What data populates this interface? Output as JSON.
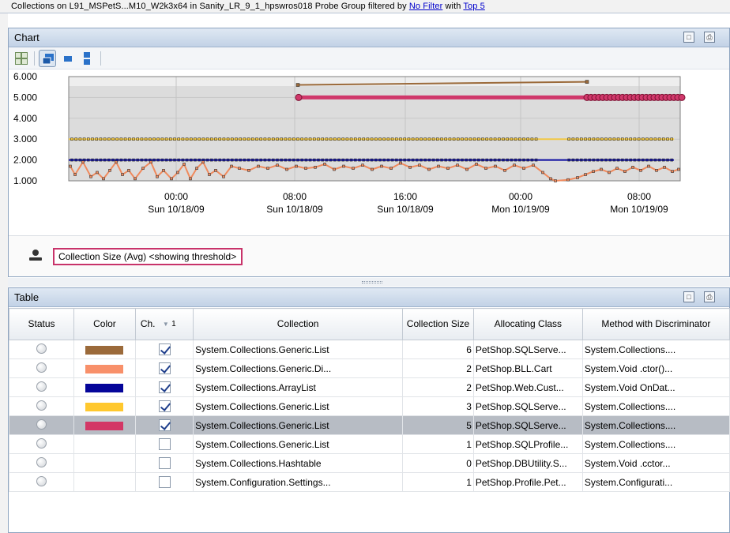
{
  "header": {
    "prefix": "Collections on L91_MSPetS...M10_W2k3x64 in Sanity_LR_9_1_hpswros018 Probe Group filtered by ",
    "filter_link": "No Filter",
    "with_text": " with ",
    "top_link": "Top 5"
  },
  "chart_panel": {
    "title": "Chart",
    "toolbar_icons": [
      "grid-view-icon",
      "overlay-view-icon",
      "single-view-icon",
      "stacked-view-icon"
    ],
    "legend_icon": "person-icon",
    "legend_label": "Collection Size (Avg) <showing threshold>"
  },
  "chart_data": {
    "type": "line",
    "y_ticks": [
      "6.000",
      "5.000",
      "4.000",
      "3.000",
      "2.000",
      "1.000"
    ],
    "ylim": [
      1,
      6
    ],
    "x_ticks": [
      {
        "time": "00:00",
        "day": "Sun 10/18/09"
      },
      {
        "time": "08:00",
        "day": "Sun 10/18/09"
      },
      {
        "time": "16:00",
        "day": "Sun 10/18/09"
      },
      {
        "time": "00:00",
        "day": "Mon 10/19/09"
      },
      {
        "time": "08:00",
        "day": "Mon 10/19/09"
      }
    ],
    "x_range_hours": [
      -12.5,
      12.5
    ],
    "grid": true,
    "series": [
      {
        "color": "#9b6a3a",
        "start_hour": 7.9,
        "end_hour": 5.6,
        "start_value": 5.6,
        "end_value": 5.75
      },
      {
        "color": "#f08a5d",
        "constant": false
      },
      {
        "color": "#0a0aa0",
        "value": 2.0
      },
      {
        "color": "#f2c744",
        "value": 3.0
      },
      {
        "color": "#d0386b",
        "value": 5.0
      }
    ]
  },
  "table_panel": {
    "title": "Table",
    "columns": [
      "Status",
      "Color",
      "Ch.",
      "Collection",
      "Collection Size",
      "Allocating Class",
      "Method with Discriminator"
    ],
    "sort_indicator": "1",
    "rows": [
      {
        "color": "#9b6a3a",
        "checked": true,
        "collection": "System.Collections.Generic.List",
        "size": "6",
        "alloc": "PetShop.SQLServe...",
        "method": "System.Collections...."
      },
      {
        "color": "#f8906a",
        "checked": true,
        "collection": "System.Collections.Generic.Di...",
        "size": "2",
        "alloc": "PetShop.BLL.Cart",
        "method": "System.Void .ctor()..."
      },
      {
        "color": "#05059a",
        "checked": true,
        "collection": "System.Collections.ArrayList",
        "size": "2",
        "alloc": "PetShop.Web.Cust...",
        "method": "System.Void OnDat..."
      },
      {
        "color": "#ffc82e",
        "checked": true,
        "collection": "System.Collections.Generic.List",
        "size": "3",
        "alloc": "PetShop.SQLServe...",
        "method": "System.Collections...."
      },
      {
        "color": "#d33766",
        "checked": true,
        "collection": "System.Collections.Generic.List",
        "size": "5",
        "alloc": "PetShop.SQLServe...",
        "method": "System.Collections....",
        "selected": true
      },
      {
        "color": "",
        "checked": false,
        "collection": "System.Collections.Generic.List",
        "size": "1",
        "alloc": "PetShop.SQLProfile...",
        "method": "System.Collections...."
      },
      {
        "color": "",
        "checked": false,
        "collection": "System.Collections.Hashtable",
        "size": "0",
        "alloc": "PetShop.DBUtility.S...",
        "method": "System.Void .cctor..."
      },
      {
        "color": "",
        "checked": false,
        "collection": "System.Configuration.Settings...",
        "size": "1",
        "alloc": "PetShop.Profile.Pet...",
        "method": "System.Configurati..."
      }
    ]
  }
}
